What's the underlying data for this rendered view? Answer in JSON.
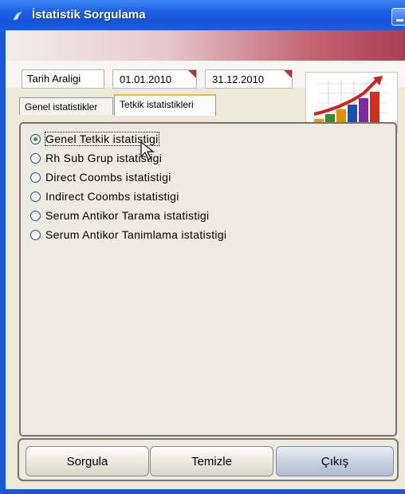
{
  "window": {
    "title": "İstatistik Sorgulama"
  },
  "dates": {
    "label": "Tarih Araligi",
    "start": "01.01.2010",
    "end": "31.12.2010"
  },
  "tabs": [
    {
      "label": "Genel istatistikler",
      "active": false
    },
    {
      "label": "Tetkik istatistikleri",
      "active": true
    }
  ],
  "options": [
    {
      "label": "Genel Tetkik istatistigi",
      "checked": true
    },
    {
      "label": "Rh Sub Grup istatistigi",
      "checked": false
    },
    {
      "label": "Direct Coombs istatistigi",
      "checked": false
    },
    {
      "label": "Indirect Coombs istatistigi",
      "checked": false
    },
    {
      "label": "Serum Antikor Tarama istatistigi",
      "checked": false
    },
    {
      "label": "Serum Antikor Tanimlama istatistigi",
      "checked": false
    }
  ],
  "buttons": {
    "query": "Sorgula",
    "clear": "Temizle",
    "exit": "Çıkış"
  },
  "colors": {
    "titlebar": "#1e63e6",
    "radio_checked": "#31a23b",
    "tab_accent": "#f2b23c",
    "date_dropdown_marker": "#a9343c"
  },
  "icons": {
    "title": "app-icon",
    "logo": "bar-chart-growth-logo"
  }
}
